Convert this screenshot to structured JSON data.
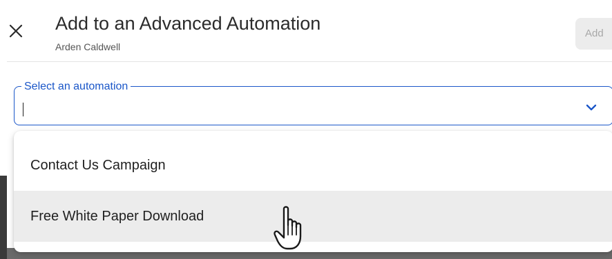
{
  "modal": {
    "title": "Add to an Advanced Automation",
    "subtitle": "Arden Caldwell",
    "add_button_label": "Add"
  },
  "select": {
    "label": "Select an automation",
    "value": "",
    "options": [
      {
        "label": "Contact Us Campaign",
        "hovered": false
      },
      {
        "label": "Free White Paper Download",
        "hovered": true
      }
    ]
  },
  "colors": {
    "accent": "#1a56c8",
    "hover_bg": "#ececec",
    "button_bg": "#ececec"
  },
  "icons": {
    "close": "close-icon",
    "chevron": "chevron-down-icon",
    "cursor": "hand-pointer-icon"
  }
}
